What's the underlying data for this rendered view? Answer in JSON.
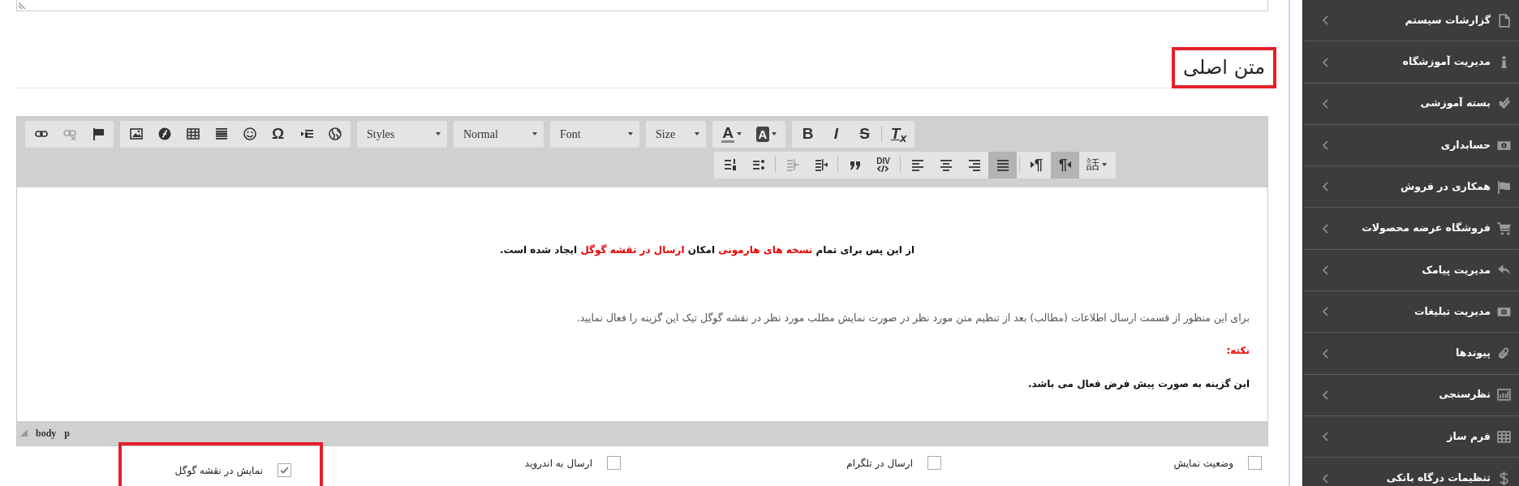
{
  "heading": {
    "text": "متن اصلی",
    "highlighted": true
  },
  "toolbar": {
    "rows": [
      {
        "groups": [
          {
            "kind": "buttons",
            "items": [
              {
                "kind": "button",
                "label": "T$_{x}$",
                "disabled": false,
                "selected": false
              },
              {
                "kind": "separator"
              },
              {
                "kind": "button",
                "label": "S",
                "disabled": false,
                "selected": false
              },
              {
                "kind": "button",
                "label": "I",
                "disabled": false,
                "selected": false
              },
              {
                "kind": "button",
                "label": "B",
                "disabled": false,
                "selected": false
              }
            ]
          },
          {
            "kind": "buttons",
            "items": [
              {
                "kind": "menu",
                "label": "A",
                "disabled": false,
                "selected": false
              },
              {
                "kind": "menu",
                "label": "A",
                "disabled": false,
                "selected": false
              }
            ]
          },
          {
            "kind": "combo",
            "label": "Size"
          },
          {
            "kind": "combo",
            "label": "Font"
          },
          {
            "kind": "combo",
            "label": "Normal"
          },
          {
            "kind": "combo",
            "label": "Styles"
          },
          {
            "kind": "buttons",
            "items": [
              {
                "kind": "button",
                "disabled": false,
                "selected": false
              },
              {
                "kind": "button",
                "disabled": false,
                "selected": false
              },
              {
                "kind": "button",
                "label": "Ω",
                "disabled": false,
                "selected": false
              },
              {
                "kind": "button",
                "disabled": false,
                "selected": false
              },
              {
                "kind": "button",
                "disabled": false,
                "selected": false
              },
              {
                "kind": "button",
                "disabled": false,
                "selected": false
              },
              {
                "kind": "button",
                "disabled": false,
                "selected": false
              },
              {
                "kind": "button",
                "disabled": false,
                "selected": false
              }
            ]
          },
          {
            "kind": "buttons",
            "items": [
              {
                "kind": "button",
                "disabled": false,
                "selected": false
              },
              {
                "kind": "button",
                "disabled": true,
                "selected": false
              },
              {
                "kind": "button",
                "disabled": false,
                "selected": false
              }
            ]
          }
        ]
      },
      {
        "groups": [
          {
            "kind": "buttons",
            "items": [
              {
                "kind": "menu",
                "label": "話",
                "disabled": false,
                "selected": false
              },
              {
                "kind": "button",
                "label": "¶",
                "disabled": false,
                "selected": true
              },
              {
                "kind": "button",
                "label": "¶",
                "disabled": false,
                "selected": false
              },
              {
                "kind": "separator"
              },
              {
                "kind": "button",
                "disabled": false,
                "selected": true
              },
              {
                "kind": "button",
                "disabled": false,
                "selected": false
              },
              {
                "kind": "button",
                "disabled": false,
                "selected": false
              },
              {
                "kind": "button",
                "disabled": false,
                "selected": false
              },
              {
                "kind": "separator"
              },
              {
                "kind": "button",
                "label": "DIV",
                "disabled": false,
                "selected": false
              },
              {
                "kind": "button",
                "disabled": false,
                "selected": false
              },
              {
                "kind": "separator"
              },
              {
                "kind": "button",
                "disabled": false,
                "selected": false
              },
              {
                "kind": "button",
                "disabled": true,
                "selected": false
              },
              {
                "kind": "separator"
              },
              {
                "kind": "button",
                "disabled": false,
                "selected": false
              },
              {
                "kind": "button",
                "disabled": false,
                "selected": false
              }
            ]
          }
        ]
      }
    ]
  },
  "content": [
    {
      "kind": "lead",
      "segments": [
        {
          "text": "از این پس برای تمام ",
          "highlight": false
        },
        {
          "text": "نسخه های هارمونی",
          "highlight": true
        },
        {
          "text": " امکان ",
          "highlight": false
        },
        {
          "text": "ارسال در نقشه گوگل",
          "highlight": true
        },
        {
          "text": " ایجاد شده است.",
          "highlight": false
        }
      ]
    },
    {
      "kind": "body",
      "text": "برای این منظور از قسمت ارسال اطلاعات (مطالب) بعد از تنظیم متن مورد نظر در صورت نمایش مطلب مورد نظر در نقشه گوگل تیک این گزینه را فعال نمایید."
    },
    {
      "kind": "note",
      "text": "نکته:"
    },
    {
      "kind": "strong",
      "text": "این گزینه به صورت پیش فرض فعال می باشد."
    }
  ],
  "status_bar": {
    "path": [
      "p",
      "body"
    ]
  },
  "options": [
    {
      "label": "وضعیت نمایش",
      "checked": false,
      "highlighted": false
    },
    {
      "label": "ارسال در تلگرام",
      "checked": false,
      "highlighted": false
    },
    {
      "label": "ارسال به اندروید",
      "checked": false,
      "highlighted": false
    },
    {
      "label": "نمایش در نقشه گوگل",
      "checked": true,
      "highlighted": true
    }
  ],
  "sidebar": {
    "items": [
      {
        "label": "گزارشات سیستم"
      },
      {
        "label": "مدیریت آموزشگاه"
      },
      {
        "label": "بسته آموزشی"
      },
      {
        "label": "حسابداری"
      },
      {
        "label": "همکاری در فروش"
      },
      {
        "label": "فروشگاه عرضه محصولات"
      },
      {
        "label": "مدیریت پیامک"
      },
      {
        "label": "مدیریت تبلیغات"
      },
      {
        "label": "پیوندها"
      },
      {
        "label": "نظرسنجی"
      },
      {
        "label": "فرم ساز"
      },
      {
        "label": "تنظیمات درگاه بانکی"
      }
    ]
  }
}
